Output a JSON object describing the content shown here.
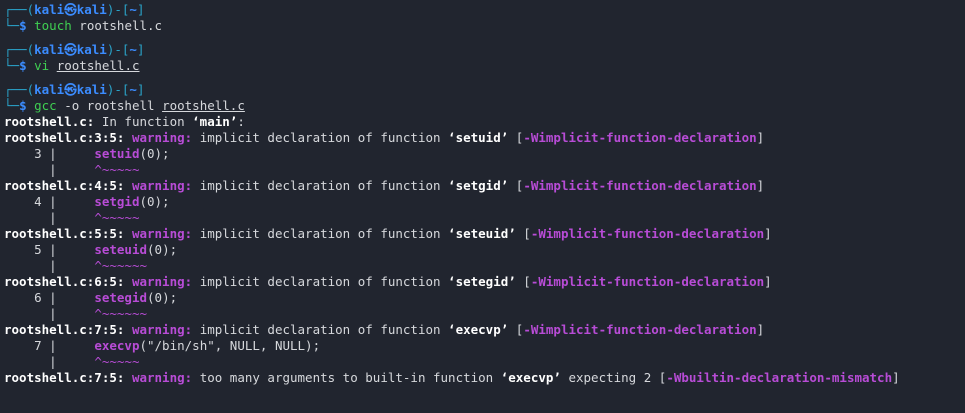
{
  "prompts": [
    {
      "user": "kali",
      "host": "kali",
      "dir": "~",
      "cmd": "touch",
      "args": " rootshell.c",
      "ul_arg": ""
    },
    {
      "user": "kali",
      "host": "kali",
      "dir": "~",
      "cmd": "vi",
      "args": " ",
      "ul_arg": "rootshell.c"
    },
    {
      "user": "kali",
      "host": "kali",
      "dir": "~",
      "cmd": "gcc",
      "args": " -o rootshell ",
      "ul_arg": "rootshell.c"
    }
  ],
  "prompt_symbols": {
    "at": "㉿",
    "dollar": "$"
  },
  "in_function": {
    "file": "rootshell.c:",
    "text": " In function ",
    "name": "‘main’",
    "tail": ":"
  },
  "warnings": [
    {
      "loc": "rootshell.c:3:5:",
      "label": "warning:",
      "msg": " implicit declaration of function ",
      "fname": "‘setuid’",
      "flag": "-Wimplicit-function-declaration",
      "lineno": "3",
      "code_call": "setuid",
      "code_rest": "(0);",
      "caret": "^~~~~~"
    },
    {
      "loc": "rootshell.c:4:5:",
      "label": "warning:",
      "msg": " implicit declaration of function ",
      "fname": "‘setgid’",
      "flag": "-Wimplicit-function-declaration",
      "lineno": "4",
      "code_call": "setgid",
      "code_rest": "(0);",
      "caret": "^~~~~~"
    },
    {
      "loc": "rootshell.c:5:5:",
      "label": "warning:",
      "msg": " implicit declaration of function ",
      "fname": "‘seteuid’",
      "flag": "-Wimplicit-function-declaration",
      "lineno": "5",
      "code_call": "seteuid",
      "code_rest": "(0);",
      "caret": "^~~~~~~"
    },
    {
      "loc": "rootshell.c:6:5:",
      "label": "warning:",
      "msg": " implicit declaration of function ",
      "fname": "‘setegid’",
      "flag": "-Wimplicit-function-declaration",
      "lineno": "6",
      "code_call": "setegid",
      "code_rest": "(0);",
      "caret": "^~~~~~~"
    },
    {
      "loc": "rootshell.c:7:5:",
      "label": "warning:",
      "msg": " implicit declaration of function ",
      "fname": "‘execvp’",
      "flag": "-Wimplicit-function-declaration",
      "lineno": "7",
      "code_call": "execvp",
      "code_rest": "(\"/bin/sh\", NULL, NULL);",
      "caret": "^~~~~~"
    }
  ],
  "final_warning": {
    "loc": "rootshell.c:7:5:",
    "label": "warning:",
    "msg": " too many arguments to built-in function ",
    "fname": "‘execvp’",
    "msg2": " expecting 2 ",
    "flag": "-Wbuiltin-declaration-mismatch"
  },
  "colors": {
    "background": "#21252f",
    "prompt": "#3b8cff",
    "box": "#2aa3c9",
    "command": "#3fcf52",
    "warning": "#b84cd6",
    "text": "#d6d8dc"
  }
}
